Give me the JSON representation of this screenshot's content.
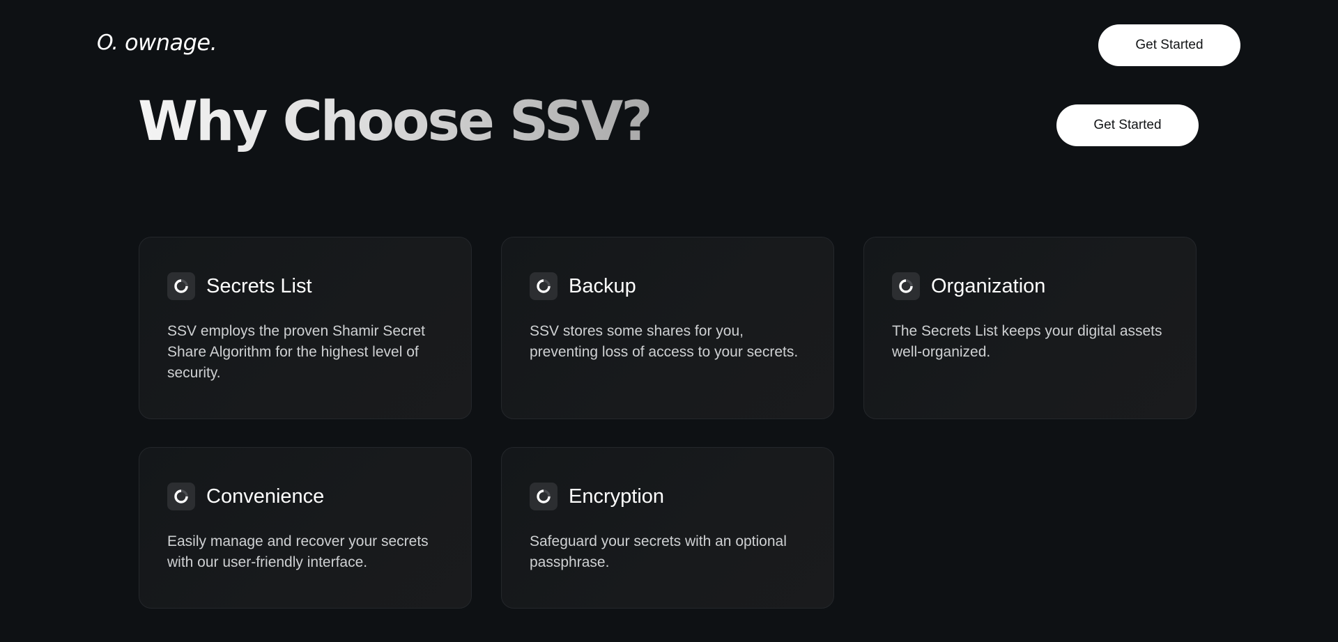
{
  "header": {
    "logo_mark": "O.",
    "logo_text": "ownage.",
    "cta_label": "Get Started"
  },
  "hero": {
    "title": "Why Choose SSV?",
    "cta_label": "Get Started"
  },
  "features": [
    {
      "title": "Secrets List",
      "description": "SSV employs the proven Shamir Secret Share Algorithm for the highest level of security.",
      "icon": "loading-spinner-icon"
    },
    {
      "title": "Backup",
      "description": "SSV stores some shares for you, preventing loss of access to your secrets.",
      "icon": "loading-spinner-icon"
    },
    {
      "title": "Organization",
      "description": "The Secrets List keeps your digital assets well-organized.",
      "icon": "loading-spinner-icon"
    },
    {
      "title": "Convenience",
      "description": "Easily manage and recover your secrets with our user-friendly interface.",
      "icon": "loading-spinner-icon"
    },
    {
      "title": "Encryption",
      "description": "Safeguard your secrets with an optional passphrase.",
      "icon": "loading-spinner-icon"
    }
  ],
  "colors": {
    "background": "#0e1114",
    "card_background": "#16181b",
    "card_border": "#24272b",
    "button_background": "#ffffff",
    "button_text": "#121416",
    "heading_gradient_start": "#f4f4f4",
    "heading_gradient_end": "#a9a9a9"
  }
}
